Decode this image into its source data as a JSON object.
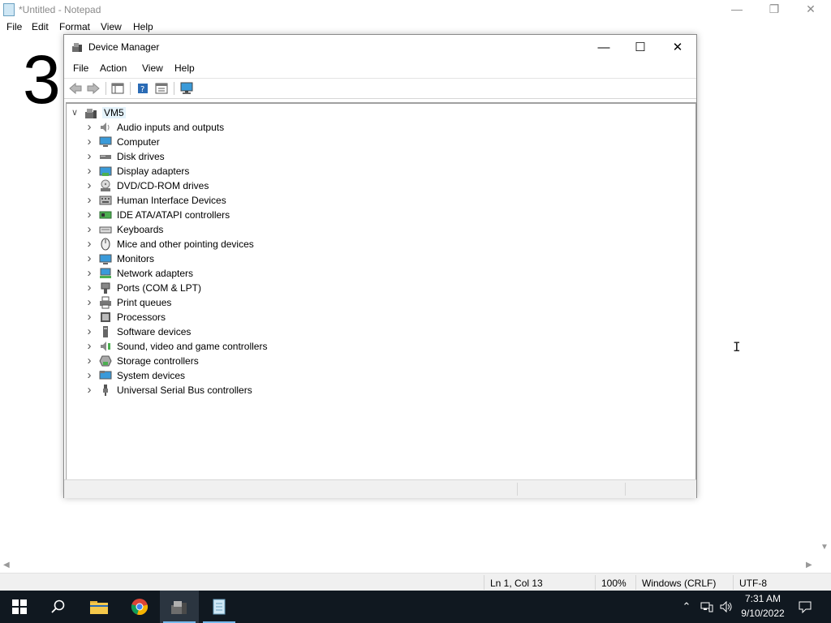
{
  "notepad": {
    "title": "*Untitled - Notepad",
    "menu": [
      "File",
      "Edit",
      "Format",
      "View",
      "Help"
    ],
    "content": "3",
    "status": {
      "position": "Ln 1, Col 13",
      "zoom": "100%",
      "line_ending": "Windows (CRLF)",
      "encoding": "UTF-8"
    }
  },
  "device_manager": {
    "title": "Device Manager",
    "menu": [
      "File",
      "Action",
      "View",
      "Help"
    ],
    "toolbar": [
      "back-icon",
      "forward-icon",
      "show-hide-console-tree-icon",
      "help-icon",
      "properties-icon",
      "monitor-icon"
    ],
    "root": "VM5",
    "categories": [
      {
        "label": "Audio inputs and outputs",
        "icon": "speaker-icon"
      },
      {
        "label": "Computer",
        "icon": "computer-icon"
      },
      {
        "label": "Disk drives",
        "icon": "disk-drive-icon"
      },
      {
        "label": "Display adapters",
        "icon": "display-adapter-icon"
      },
      {
        "label": "DVD/CD-ROM drives",
        "icon": "dvd-drive-icon"
      },
      {
        "label": "Human Interface Devices",
        "icon": "hid-icon"
      },
      {
        "label": "IDE ATA/ATAPI controllers",
        "icon": "ide-controller-icon"
      },
      {
        "label": "Keyboards",
        "icon": "keyboard-icon"
      },
      {
        "label": "Mice and other pointing devices",
        "icon": "mouse-icon"
      },
      {
        "label": "Monitors",
        "icon": "monitor-icon"
      },
      {
        "label": "Network adapters",
        "icon": "network-adapter-icon"
      },
      {
        "label": "Ports (COM & LPT)",
        "icon": "port-icon"
      },
      {
        "label": "Print queues",
        "icon": "printer-icon"
      },
      {
        "label": "Processors",
        "icon": "processor-icon"
      },
      {
        "label": "Software devices",
        "icon": "software-device-icon"
      },
      {
        "label": "Sound, video and game controllers",
        "icon": "sound-controller-icon"
      },
      {
        "label": "Storage controllers",
        "icon": "storage-controller-icon"
      },
      {
        "label": "System devices",
        "icon": "system-device-icon"
      },
      {
        "label": "Universal Serial Bus controllers",
        "icon": "usb-icon"
      }
    ]
  },
  "taskbar": {
    "apps": [
      "start-icon",
      "search-icon",
      "file-explorer-icon",
      "chrome-icon",
      "device-manager-icon",
      "notepad-icon"
    ],
    "clock_time": "7:31 AM",
    "clock_date": "9/10/2022"
  },
  "colors": {
    "taskbar": "#101820",
    "selection": "#e5f3fb",
    "accent": "#76b9ed"
  }
}
